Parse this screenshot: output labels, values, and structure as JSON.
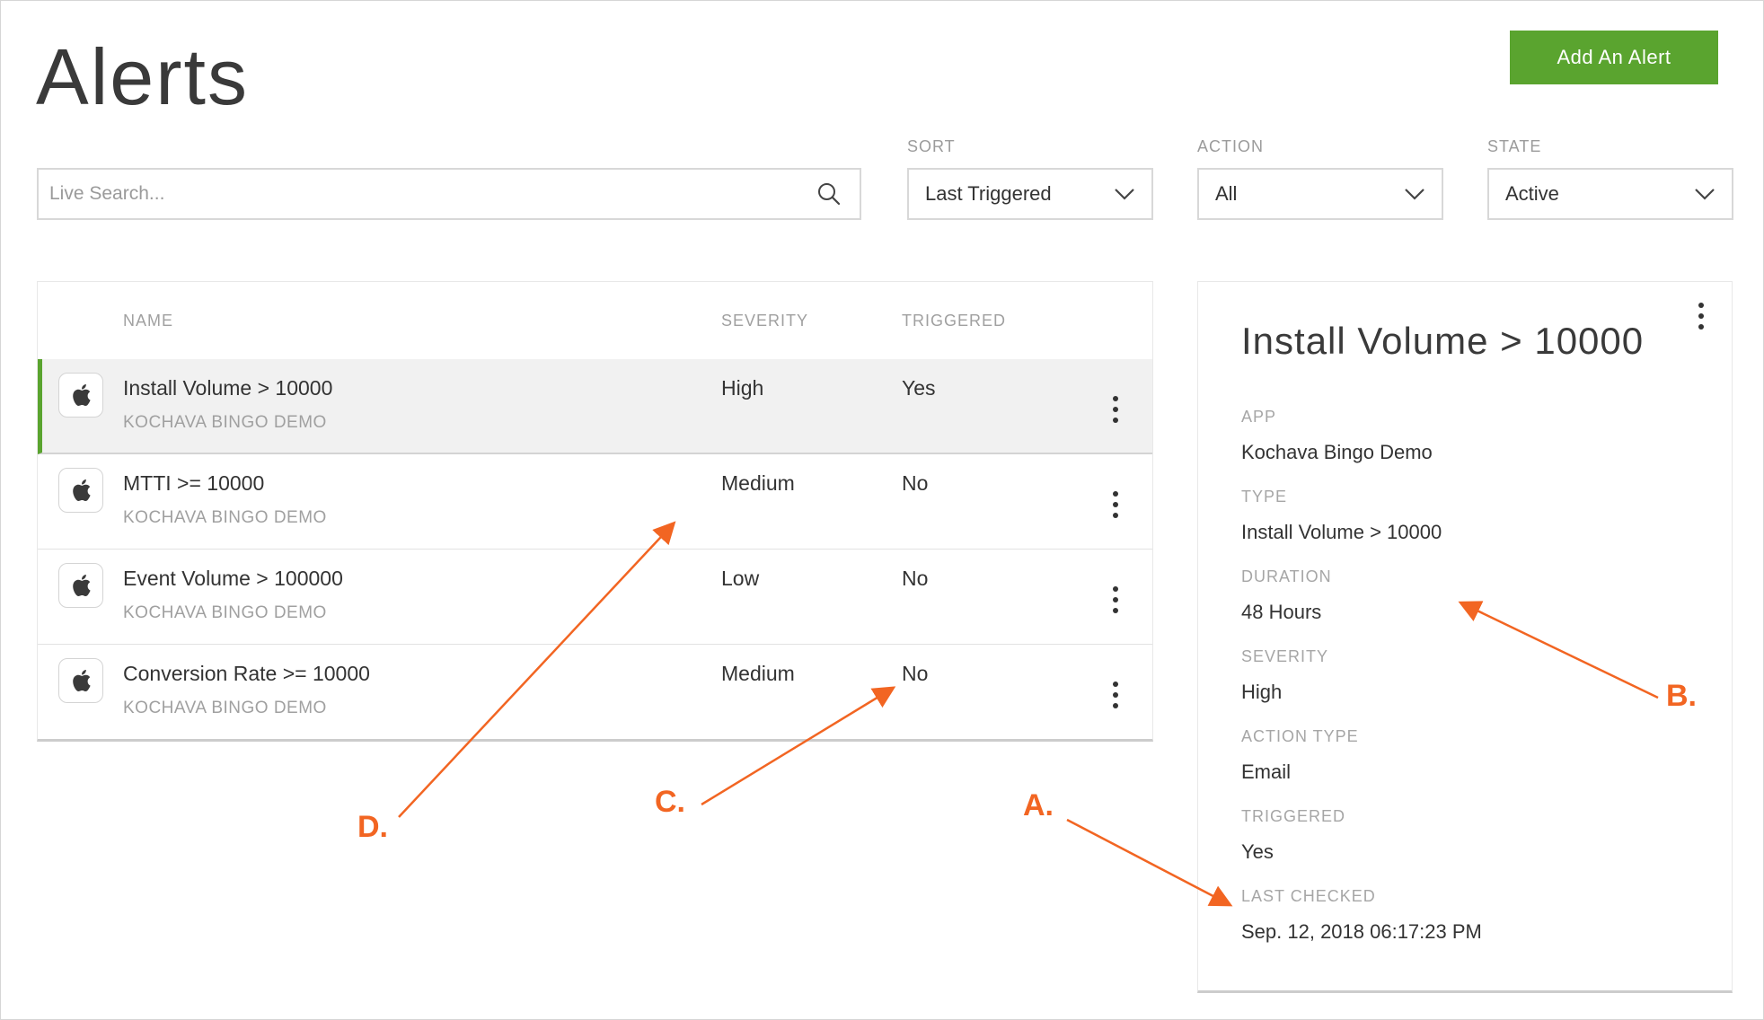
{
  "page": {
    "title": "Alerts",
    "add_button_label": "Add An Alert"
  },
  "search": {
    "placeholder": "Live Search..."
  },
  "filters": {
    "sort": {
      "label": "SORT",
      "value": "Last Triggered"
    },
    "action": {
      "label": "ACTION",
      "value": "All"
    },
    "state": {
      "label": "STATE",
      "value": "Active"
    }
  },
  "table": {
    "columns": [
      "NAME",
      "SEVERITY",
      "TRIGGERED"
    ],
    "rows": [
      {
        "name": "Install Volume > 10000",
        "app": "KOCHAVA BINGO DEMO",
        "severity": "High",
        "triggered": "Yes",
        "selected": true
      },
      {
        "name": "MTTI >= 10000",
        "app": "KOCHAVA BINGO DEMO",
        "severity": "Medium",
        "triggered": "No",
        "selected": false
      },
      {
        "name": "Event Volume > 100000",
        "app": "KOCHAVA BINGO DEMO",
        "severity": "Low",
        "triggered": "No",
        "selected": false
      },
      {
        "name": "Conversion Rate >= 10000",
        "app": "KOCHAVA BINGO DEMO",
        "severity": "Medium",
        "triggered": "No",
        "selected": false
      }
    ]
  },
  "detail": {
    "title": "Install Volume > 10000",
    "fields": [
      {
        "label": "APP",
        "value": "Kochava Bingo Demo"
      },
      {
        "label": "TYPE",
        "value": "Install Volume > 10000"
      },
      {
        "label": "DURATION",
        "value": "48 Hours"
      },
      {
        "label": "SEVERITY",
        "value": "High"
      },
      {
        "label": "ACTION TYPE",
        "value": "Email"
      },
      {
        "label": "TRIGGERED",
        "value": "Yes"
      },
      {
        "label": "LAST CHECKED",
        "value": "Sep. 12, 2018 06:17:23 PM"
      }
    ]
  },
  "annotations": {
    "color": "#f26522",
    "markers": [
      "A.",
      "B.",
      "C.",
      "D."
    ]
  },
  "colors": {
    "accent_green": "#5aa42f",
    "annotation_orange": "#f26522"
  },
  "icons": {
    "app_icon": "apple-icon",
    "search": "search-icon",
    "dropdown": "chevron-down-icon",
    "menu": "kebab-menu-icon"
  }
}
